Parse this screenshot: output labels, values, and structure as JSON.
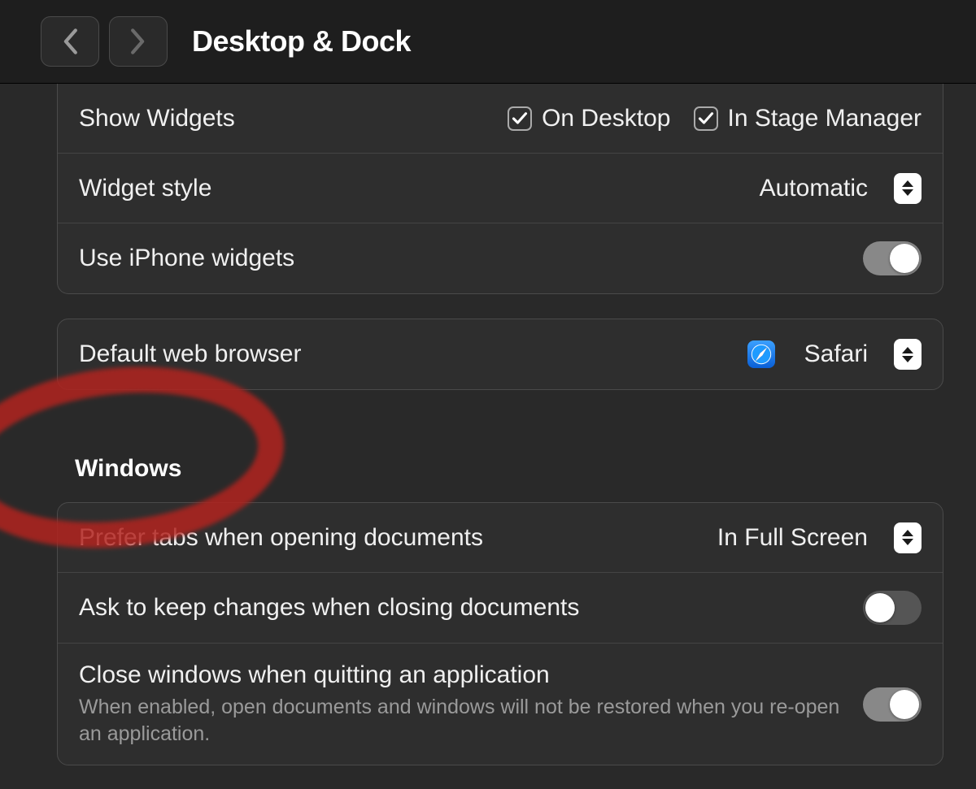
{
  "header": {
    "title": "Desktop & Dock"
  },
  "widgets": {
    "show_label": "Show Widgets",
    "on_desktop_label": "On Desktop",
    "in_stage_manager_label": "In Stage Manager",
    "on_desktop_checked": true,
    "in_stage_manager_checked": true,
    "style_label": "Widget style",
    "style_value": "Automatic",
    "iphone_label": "Use iPhone widgets",
    "iphone_on": true
  },
  "browser": {
    "label": "Default web browser",
    "value": "Safari"
  },
  "windows": {
    "heading": "Windows",
    "tabs_label": "Prefer tabs when opening documents",
    "tabs_value": "In Full Screen",
    "ask_label": "Ask to keep changes when closing documents",
    "ask_on": false,
    "close_label": "Close windows when quitting an application",
    "close_desc": "When enabled, open documents and windows will not be restored when you re-open an application.",
    "close_on": true
  }
}
